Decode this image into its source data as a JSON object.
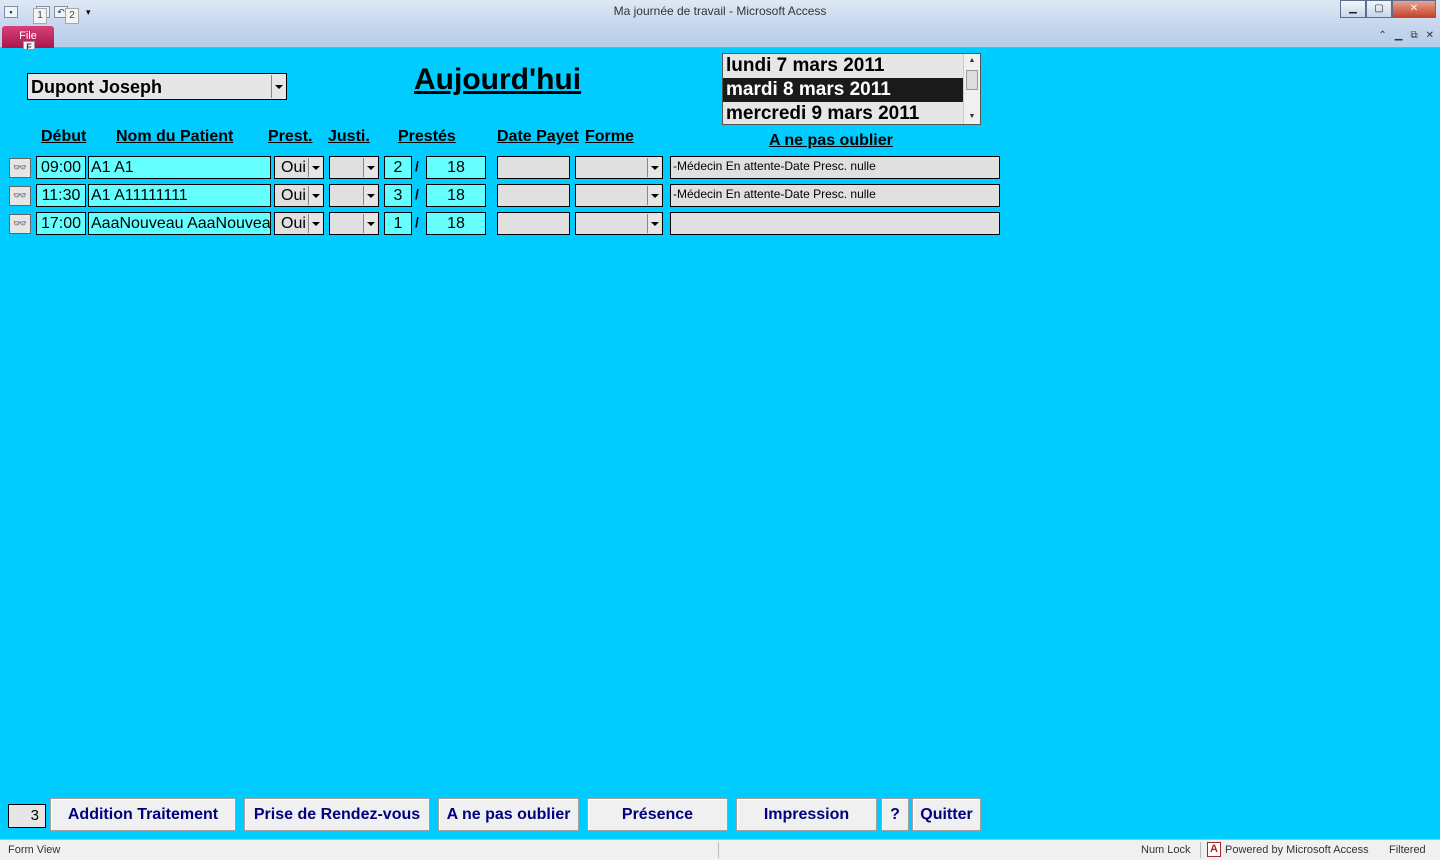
{
  "window": {
    "title": "Ma journée de travail  -  Microsoft Access",
    "file_tab": "File",
    "file_key": "F",
    "qat_keys": [
      "1",
      "2"
    ],
    "controls": {
      "minimize": "▁",
      "maximize": "▢",
      "close": "✕"
    },
    "ribbon_controls": [
      "⌃",
      "▁",
      "⧉",
      "✕"
    ]
  },
  "form": {
    "therapist": "Dupont Joseph",
    "heading": "Aujourd'hui",
    "dates": [
      {
        "label": "lundi 7 mars 2011",
        "selected": false
      },
      {
        "label": "mardi 8 mars 2011",
        "selected": true
      },
      {
        "label": "mercredi 9 mars 2011",
        "selected": false
      }
    ],
    "columns": {
      "debut": "Début",
      "patient": "Nom du Patient",
      "prest": "Prest.",
      "justi": "Justi.",
      "prestes": "Prestés",
      "date_payet": "Date Payet",
      "forme": "Forme",
      "rappel": "A ne pas oublier"
    },
    "rows": [
      {
        "time": "09:00",
        "patient": "A1 A1",
        "prest": "Oui",
        "justi": "",
        "done": "2",
        "sep": "/",
        "total": "18",
        "date_payet": "",
        "forme": "",
        "note": "-Médecin  En attente-Date Presc. nulle"
      },
      {
        "time": "11:30",
        "patient": "A1 A11111111",
        "prest": "Oui",
        "justi": "",
        "done": "3",
        "sep": "/",
        "total": "18",
        "date_payet": "",
        "forme": "",
        "note": "-Médecin  En attente-Date Presc. nulle"
      },
      {
        "time": "17:00",
        "patient": "AaaNouveau AaaNouveau",
        "prest": "Oui",
        "justi": "",
        "done": "1",
        "sep": "/",
        "total": "18",
        "date_payet": "",
        "forme": "",
        "note": ""
      }
    ],
    "row_icon": "glasses-icon",
    "row_icon_glyph": "👓"
  },
  "footer": {
    "record_count": "3",
    "buttons": {
      "addition": "Addition Traitement",
      "rdv": "Prise de Rendez-vous",
      "rappel": "A ne pas oublier",
      "presence": "Présence",
      "impression": "Impression",
      "help": "?",
      "quit": "Quitter"
    }
  },
  "statusbar": {
    "view": "Form View",
    "numlock": "Num Lock",
    "powered": "Powered by Microsoft Access",
    "filtered": "Filtered"
  },
  "colors": {
    "form_bg": "#00ccff",
    "field_cyan": "#66ffff",
    "button_text": "#000080",
    "file_tab": "#c0185a"
  }
}
